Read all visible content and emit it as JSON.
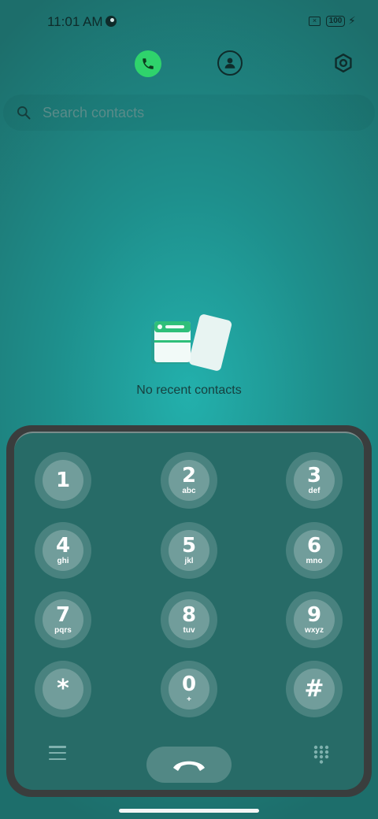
{
  "status_bar": {
    "time": "11:01 AM",
    "sim_icon": "sim-x-icon",
    "battery": "100",
    "charging_icon": "bolt-icon"
  },
  "top_nav": {
    "phone_tab_icon": "phone-icon",
    "contacts_tab_icon": "person-icon",
    "settings_icon": "gear-icon",
    "accent": "#2fd36c"
  },
  "search": {
    "placeholder": "Search contacts"
  },
  "empty_state": {
    "message": "No recent contacts",
    "icon": "contacts-cards-icon"
  },
  "dialpad": {
    "keys": [
      {
        "digit": "1",
        "letters": ""
      },
      {
        "digit": "2",
        "letters": "abc"
      },
      {
        "digit": "3",
        "letters": "def"
      },
      {
        "digit": "4",
        "letters": "ghi"
      },
      {
        "digit": "5",
        "letters": "jkl"
      },
      {
        "digit": "6",
        "letters": "mno"
      },
      {
        "digit": "7",
        "letters": "pqrs"
      },
      {
        "digit": "8",
        "letters": "tuv"
      },
      {
        "digit": "9",
        "letters": "wxyz"
      },
      {
        "digit": "*",
        "letters": ""
      },
      {
        "digit": "0",
        "letters": "+"
      },
      {
        "digit": "#",
        "letters": ""
      }
    ],
    "menu_icon": "menu-icon",
    "call_icon": "phone-hangup-icon",
    "keypad_icon": "keypad-icon"
  }
}
